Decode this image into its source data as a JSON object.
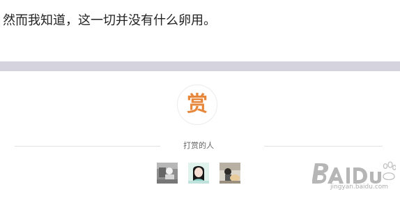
{
  "article": {
    "last_paragraph": "然而我知道，这一切并没有什么卵用。"
  },
  "reward": {
    "button_glyph": "赏",
    "section_title": "打赏的人",
    "accent_color": "#e7873c",
    "supporters": [
      {
        "avatar": "avatar-1"
      },
      {
        "avatar": "avatar-2"
      },
      {
        "avatar": "avatar-3"
      }
    ]
  },
  "watermark": {
    "logo_text": "Baidu 经验",
    "url": "jingyan.baidu.com"
  }
}
